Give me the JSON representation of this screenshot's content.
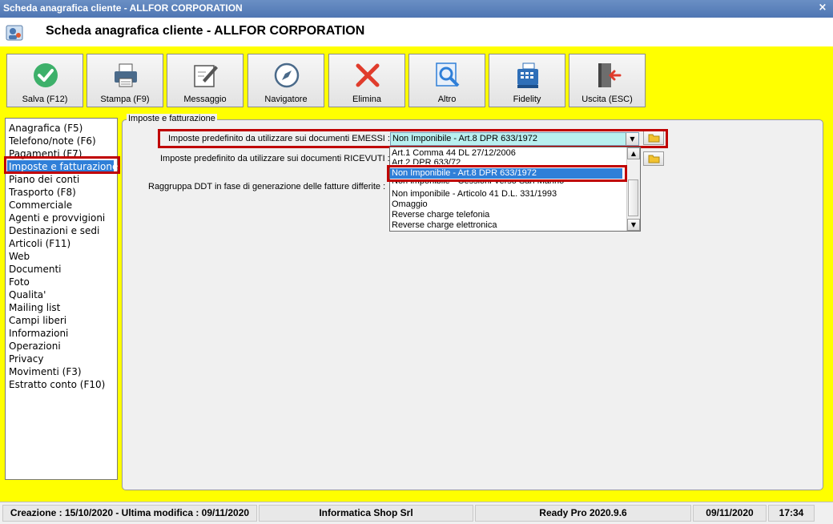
{
  "window": {
    "title": "Scheda anagrafica cliente - ALLFOR CORPORATION",
    "close": "×"
  },
  "header": {
    "title": "Scheda anagrafica cliente - ALLFOR CORPORATION",
    "icon": "customer-card-icon"
  },
  "toolbar": [
    {
      "label": "Salva (F12)",
      "icon": "check-icon",
      "color": "#3db06a"
    },
    {
      "label": "Stampa (F9)",
      "icon": "printer-icon",
      "color": "#4a6a8a"
    },
    {
      "label": "Messaggio",
      "icon": "message-icon",
      "color": "#555555"
    },
    {
      "label": "Navigatore",
      "icon": "compass-icon",
      "color": "#4a6a8a"
    },
    {
      "label": "Elimina",
      "icon": "delete-x-icon",
      "color": "#e03c2c"
    },
    {
      "label": "Altro",
      "icon": "search-doc-icon",
      "color": "#2f7fd8"
    },
    {
      "label": "Fidelity",
      "icon": "cash-register-icon",
      "color": "#2f6fb8"
    },
    {
      "label": "Uscita (ESC)",
      "icon": "exit-door-icon",
      "color": "#e03c2c"
    }
  ],
  "nav": {
    "items": [
      "Anagrafica (F5)",
      "Telefono/note (F6)",
      "Pagamenti (F7)",
      "Imposte e fatturazione",
      "Piano dei conti",
      "Trasporto (F8)",
      "Commerciale",
      "Agenti e provvigioni",
      "Destinazioni e sedi",
      "Articoli (F11)",
      "Web",
      "Documenti",
      "Foto",
      "Qualita'",
      "Mailing list",
      "Campi liberi",
      "Informazioni",
      "Operazioni",
      "Privacy",
      "Movimenti (F3)",
      "Estratto conto (F10)"
    ],
    "selected": "Imposte e fatturazione"
  },
  "group": {
    "title": "Imposte e fatturazione",
    "emessi_label": "Imposte predefinito da utilizzare sui documenti EMESSI :",
    "ricevuti_label": "Imposte predefinito da utilizzare sui documenti RICEVUTI :",
    "raggruppa_label": "Raggruppa DDT in fase di generazione delle fatture differite :",
    "emessi_value": "Non Imponibile - Art.8 DPR 633/1972"
  },
  "dropdown": {
    "options": [
      "Art.1 Comma 44 DL 27/12/2006",
      "Art.2 DPR 633/72",
      "Non Imponibile - Art.8 DPR 633/1972",
      "Non imponibile - Cessioni Verso San Marino",
      "Non imponibile - Articolo 41 D.L. 331/1993",
      "Omaggio",
      "Reverse charge telefonia",
      "Reverse charge elettronica"
    ],
    "selected": "Non Imponibile - Art.8 DPR 633/1972"
  },
  "status": {
    "dates": "Creazione : 15/10/2020 - Ultima modifica : 09/11/2020",
    "company": "Informatica Shop Srl",
    "version": "Ready Pro 2020.9.6",
    "date": "09/11/2020",
    "time": "17:34"
  },
  "colors": {
    "accent": "#ffff00",
    "highlight": "#c00000",
    "selection": "#2f7fd8"
  }
}
